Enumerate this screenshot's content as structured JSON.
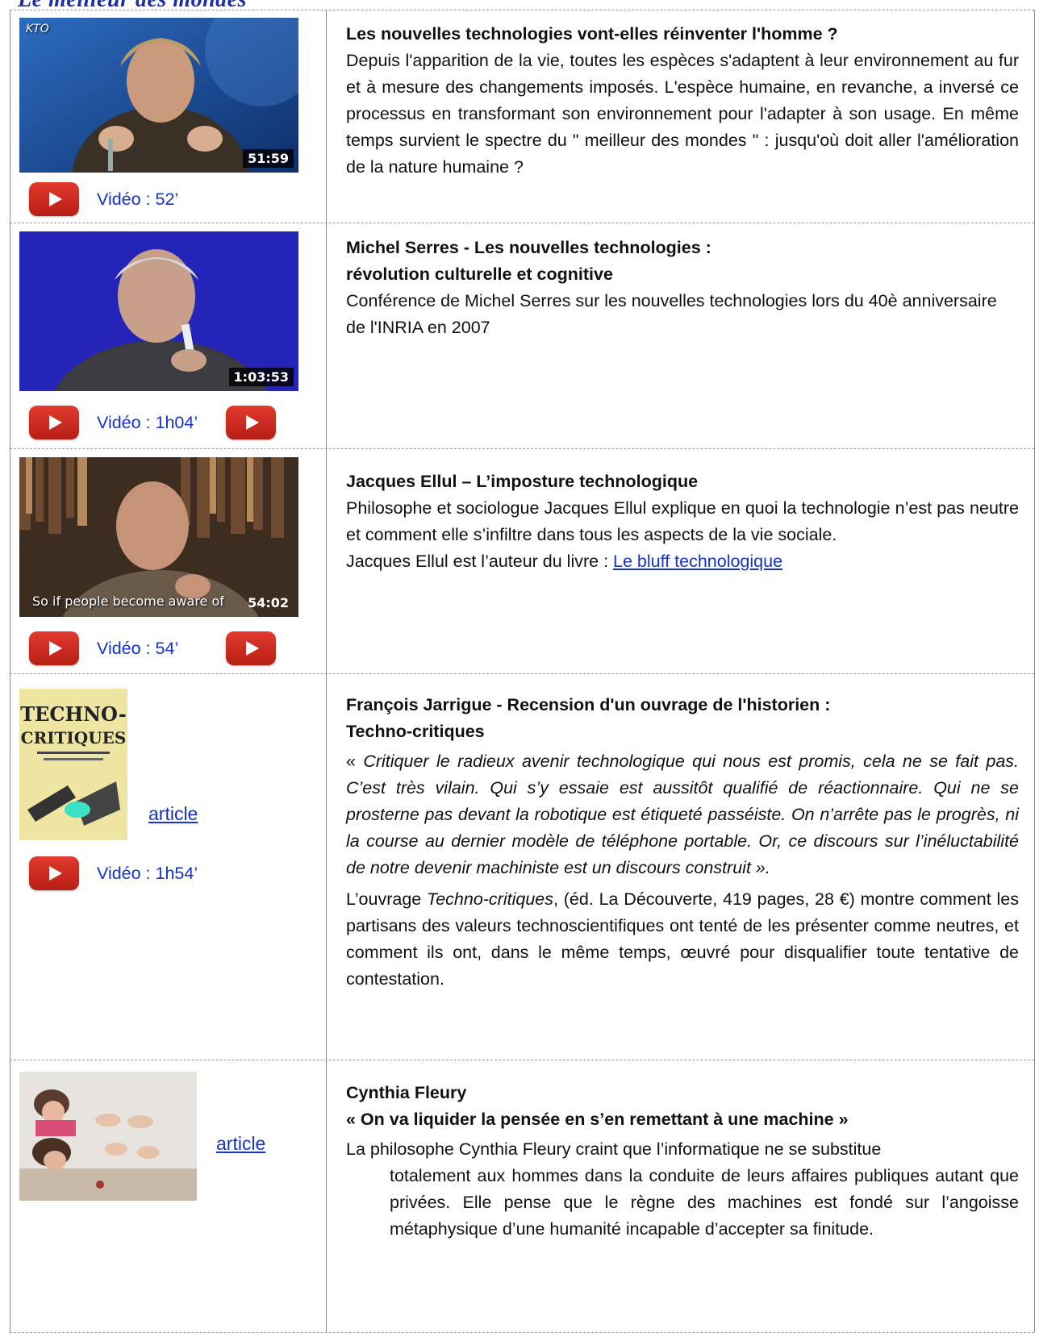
{
  "page_heading": "Le meilleur des mondes",
  "rows": [
    {
      "thumb_duration": "51:59",
      "channel_logo": "KTO",
      "video_label": "Vidéo : 52’",
      "title": "Les nouvelles technologies vont-elles réinventer l'homme ?",
      "body": "Depuis l'apparition de la vie, toutes les espèces s'adaptent à leur environnement au fur et à mesure des changements imposés. L'espèce humaine, en revanche, a inversé ce processus en transformant son environnement pour l'adapter à son usage. En même temps survient le spectre du \" meilleur des mondes \" : jusqu'où doit aller l'amélioration de la nature humaine ?"
    },
    {
      "thumb_duration": "1:03:53",
      "video_label": "Vidéo : 1h04’",
      "title_line1": "Michel Serres - Les nouvelles technologies :",
      "title_line2": "révolution culturelle et cognitive",
      "body": "Conférence de Michel Serres sur les nouvelles technologies lors du 40è anniversaire de l'INRIA en 2007"
    },
    {
      "thumb_duration": "54:02",
      "thumb_subtitle": "So if people become aware of",
      "video_label": "Vidéo : 54’",
      "title": "Jacques Ellul – L’imposture technologique",
      "body": "Philosophe et sociologue Jacques Ellul explique en quoi la technologie n’est pas neutre et comment elle s’infiltre dans tous les aspects de la vie sociale.",
      "author_prefix": "Jacques Ellul est l’auteur du livre : ",
      "book_link": "Le bluff technologique"
    },
    {
      "book_cover_title1": "TECHNO-",
      "book_cover_title2": "CRITIQUES",
      "article_link": "article",
      "video_label": "Vidéo : 1h54’",
      "title_line1": "François Jarrigue - Recension d'un ouvrage de l'historien :",
      "title_line2": "Techno-critiques",
      "quote_open": "« ",
      "quote": "Critiquer le radieux avenir technologique qui nous est promis, cela ne se fait pas. C’est très vilain. Qui s’y essaie est aussitôt qualifié de réactionnaire. Qui ne se prosterne pas devant la robotique est étiqueté passéiste. On n’arrête pas le progrès, ni la course au dernier modèle de téléphone portable. Or, ce discours sur l’inéluctabilité de notre devenir machiniste est un discours construit ».",
      "body_prefix": "L’ouvrage ",
      "body_italic": "Techno-critiques",
      "body_rest": ", (éd. La Découverte, 419 pages, 28 €) montre comment les partisans des valeurs technoscientifiques ont tenté de les présenter comme neutres, et comment ils ont, dans le même temps, œuvré pour disqualifier toute tentative de contestation."
    },
    {
      "article_link": "article",
      "title_line1": "Cynthia Fleury",
      "title_line2": "« On va liquider la pensée en s’en remettant à une machine »",
      "body_first": "La philosophe Cynthia Fleury craint que l’informatique ne se substitue",
      "body_rest": "totalement aux hommes dans la conduite de leurs affaires publiques autant que privées. Elle pense que le règne des machines est fondé sur l’angoisse métaphysique d’une humanité incapable d’accepter sa finitude."
    }
  ]
}
